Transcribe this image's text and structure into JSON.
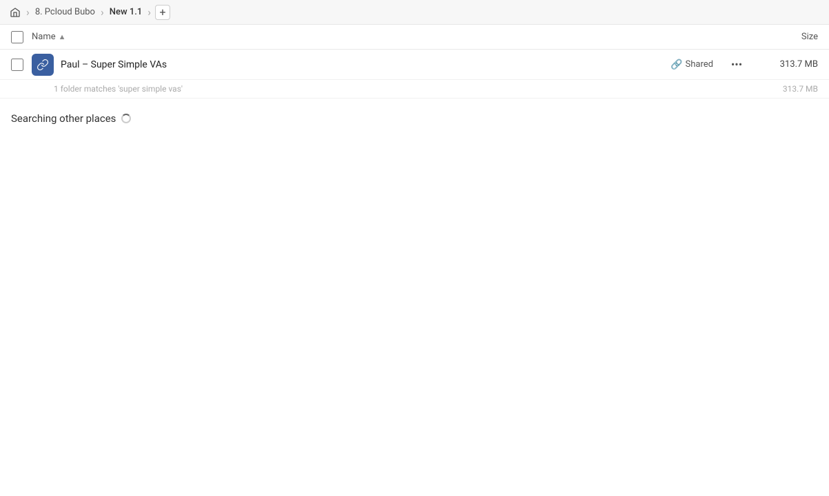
{
  "topbar": {
    "breadcrumbs": [
      {
        "label": "Home",
        "type": "home"
      },
      {
        "label": "8. Pcloud Bubo",
        "type": "item"
      },
      {
        "label": "New 1.1",
        "type": "item",
        "active": true
      }
    ],
    "add_button_label": "+"
  },
  "column_headers": {
    "name_label": "Name",
    "sort_indicator": "▲",
    "size_label": "Size"
  },
  "file_row": {
    "icon_type": "link",
    "name": "Paul – Super Simple VAs",
    "shared_label": "Shared",
    "more_label": "•••",
    "size": "313.7 MB"
  },
  "match_info": {
    "text": "1 folder matches 'super simple vas'",
    "size": "313.7 MB"
  },
  "searching_section": {
    "label": "Searching other places"
  }
}
